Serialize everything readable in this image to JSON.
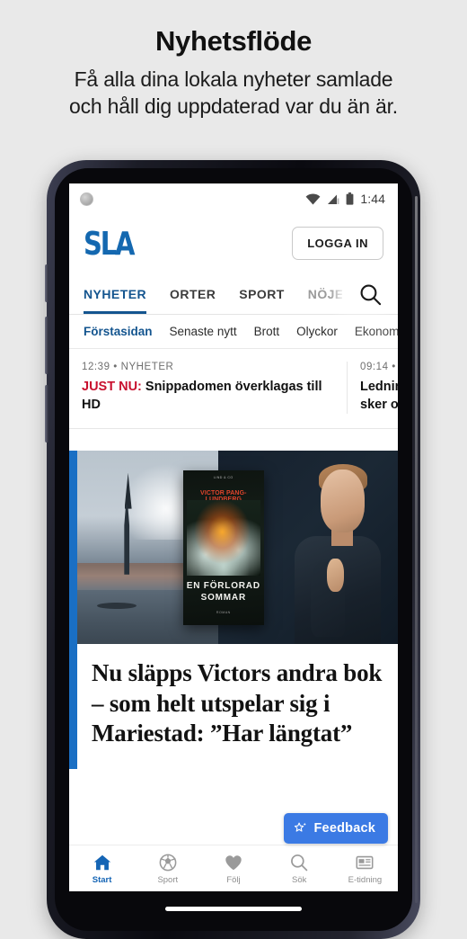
{
  "promo": {
    "title": "Nyhetsflöde",
    "subtitle_line1": "Få alla dina lokala nyheter samlade",
    "subtitle_line2": "och håll dig uppdaterad var du än är."
  },
  "status_bar": {
    "clock": "1:44",
    "icons": [
      "wifi-icon",
      "cellular-signal-icon",
      "battery-icon"
    ]
  },
  "app_header": {
    "logo_text": "SLA",
    "login_label": "LOGGA IN"
  },
  "main_tabs": [
    {
      "label": "NYHETER",
      "active": true
    },
    {
      "label": "ORTER",
      "active": false
    },
    {
      "label": "SPORT",
      "active": false
    },
    {
      "label": "NÖJE/KU",
      "active": false,
      "truncated": true
    }
  ],
  "search_icon": "search-icon",
  "sub_tabs": [
    {
      "label": "Förstasidan",
      "active": true
    },
    {
      "label": "Senaste nytt",
      "active": false
    },
    {
      "label": "Brott",
      "active": false
    },
    {
      "label": "Olyckor",
      "active": false
    },
    {
      "label": "Ekonomi",
      "active": false,
      "truncated": true
    }
  ],
  "ticker": [
    {
      "time": "12:39",
      "separator": "•",
      "category": "NYHETER",
      "flash": "JUST NU:",
      "title": " Snippadomen överklagas till HD"
    },
    {
      "time": "09:14",
      "separator": "•",
      "category": "N",
      "title_line1": "Ledning",
      "title_line2": "sker om"
    }
  ],
  "article": {
    "headline": "Nu släpps Victors andra bok – som helt utspelar sig i Mariestad: ”Har längtat”",
    "book_cover": {
      "publisher": "LIND & CO",
      "author": "VICTOR PANG-LUNDBERG",
      "title_line1": "EN FÖRLORAD",
      "title_line2": "SOMMAR",
      "footer": "ROMAN"
    }
  },
  "feedback_button": {
    "label": "Feedback",
    "icon": "sparkle-star-icon",
    "color": "#3b7ae4"
  },
  "bottom_nav": [
    {
      "label": "Start",
      "icon": "home-icon",
      "active": true
    },
    {
      "label": "Sport",
      "icon": "soccer-ball-icon",
      "active": false
    },
    {
      "label": "Följ",
      "icon": "heart-icon",
      "active": false
    },
    {
      "label": "Sök",
      "icon": "search-icon",
      "active": false
    },
    {
      "label": "E-tidning",
      "icon": "newspaper-icon",
      "active": false
    }
  ],
  "colors": {
    "brand_blue": "#1468b0",
    "accent_blue": "#1a6fc4",
    "tab_active": "#14558f",
    "flash_red": "#c8102e",
    "page_background": "#e9e9e9"
  }
}
